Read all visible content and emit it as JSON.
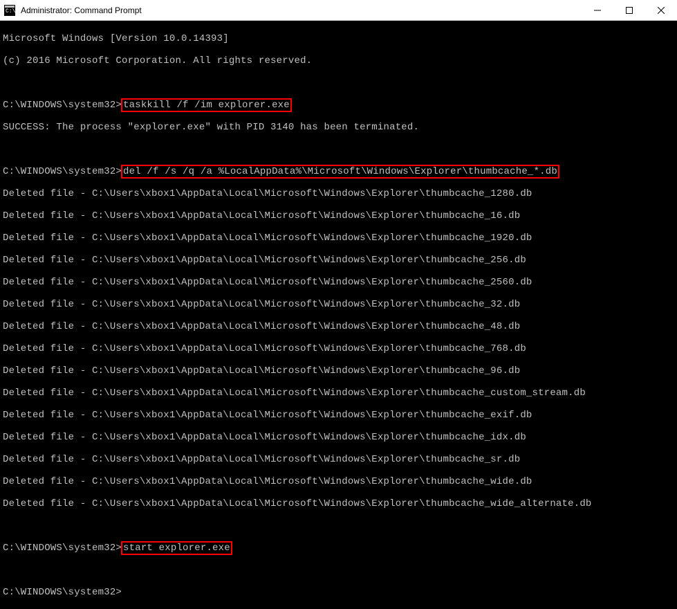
{
  "titlebar": {
    "title": "Administrator: Command Prompt"
  },
  "terminal": {
    "version_line": "Microsoft Windows [Version 10.0.14393]",
    "copyright_line": "(c) 2016 Microsoft Corporation. All rights reserved.",
    "prompt1_prefix": "C:\\WINDOWS\\system32>",
    "cmd1": "taskkill /f /im explorer.exe",
    "success_line": "SUCCESS: The process \"explorer.exe\" with PID 3140 has been terminated.",
    "prompt2_prefix": "C:\\WINDOWS\\system32>",
    "cmd2": "del /f /s /q /a %LocalAppData%\\Microsoft\\Windows\\Explorer\\thumbcache_*.db",
    "deleted_lines": [
      "Deleted file - C:\\Users\\xbox1\\AppData\\Local\\Microsoft\\Windows\\Explorer\\thumbcache_1280.db",
      "Deleted file - C:\\Users\\xbox1\\AppData\\Local\\Microsoft\\Windows\\Explorer\\thumbcache_16.db",
      "Deleted file - C:\\Users\\xbox1\\AppData\\Local\\Microsoft\\Windows\\Explorer\\thumbcache_1920.db",
      "Deleted file - C:\\Users\\xbox1\\AppData\\Local\\Microsoft\\Windows\\Explorer\\thumbcache_256.db",
      "Deleted file - C:\\Users\\xbox1\\AppData\\Local\\Microsoft\\Windows\\Explorer\\thumbcache_2560.db",
      "Deleted file - C:\\Users\\xbox1\\AppData\\Local\\Microsoft\\Windows\\Explorer\\thumbcache_32.db",
      "Deleted file - C:\\Users\\xbox1\\AppData\\Local\\Microsoft\\Windows\\Explorer\\thumbcache_48.db",
      "Deleted file - C:\\Users\\xbox1\\AppData\\Local\\Microsoft\\Windows\\Explorer\\thumbcache_768.db",
      "Deleted file - C:\\Users\\xbox1\\AppData\\Local\\Microsoft\\Windows\\Explorer\\thumbcache_96.db",
      "Deleted file - C:\\Users\\xbox1\\AppData\\Local\\Microsoft\\Windows\\Explorer\\thumbcache_custom_stream.db",
      "Deleted file - C:\\Users\\xbox1\\AppData\\Local\\Microsoft\\Windows\\Explorer\\thumbcache_exif.db",
      "Deleted file - C:\\Users\\xbox1\\AppData\\Local\\Microsoft\\Windows\\Explorer\\thumbcache_idx.db",
      "Deleted file - C:\\Users\\xbox1\\AppData\\Local\\Microsoft\\Windows\\Explorer\\thumbcache_sr.db",
      "Deleted file - C:\\Users\\xbox1\\AppData\\Local\\Microsoft\\Windows\\Explorer\\thumbcache_wide.db",
      "Deleted file - C:\\Users\\xbox1\\AppData\\Local\\Microsoft\\Windows\\Explorer\\thumbcache_wide_alternate.db"
    ],
    "prompt3_prefix": "C:\\WINDOWS\\system32>",
    "cmd3": "start explorer.exe",
    "prompt4_prefix": "C:\\WINDOWS\\system32>"
  }
}
